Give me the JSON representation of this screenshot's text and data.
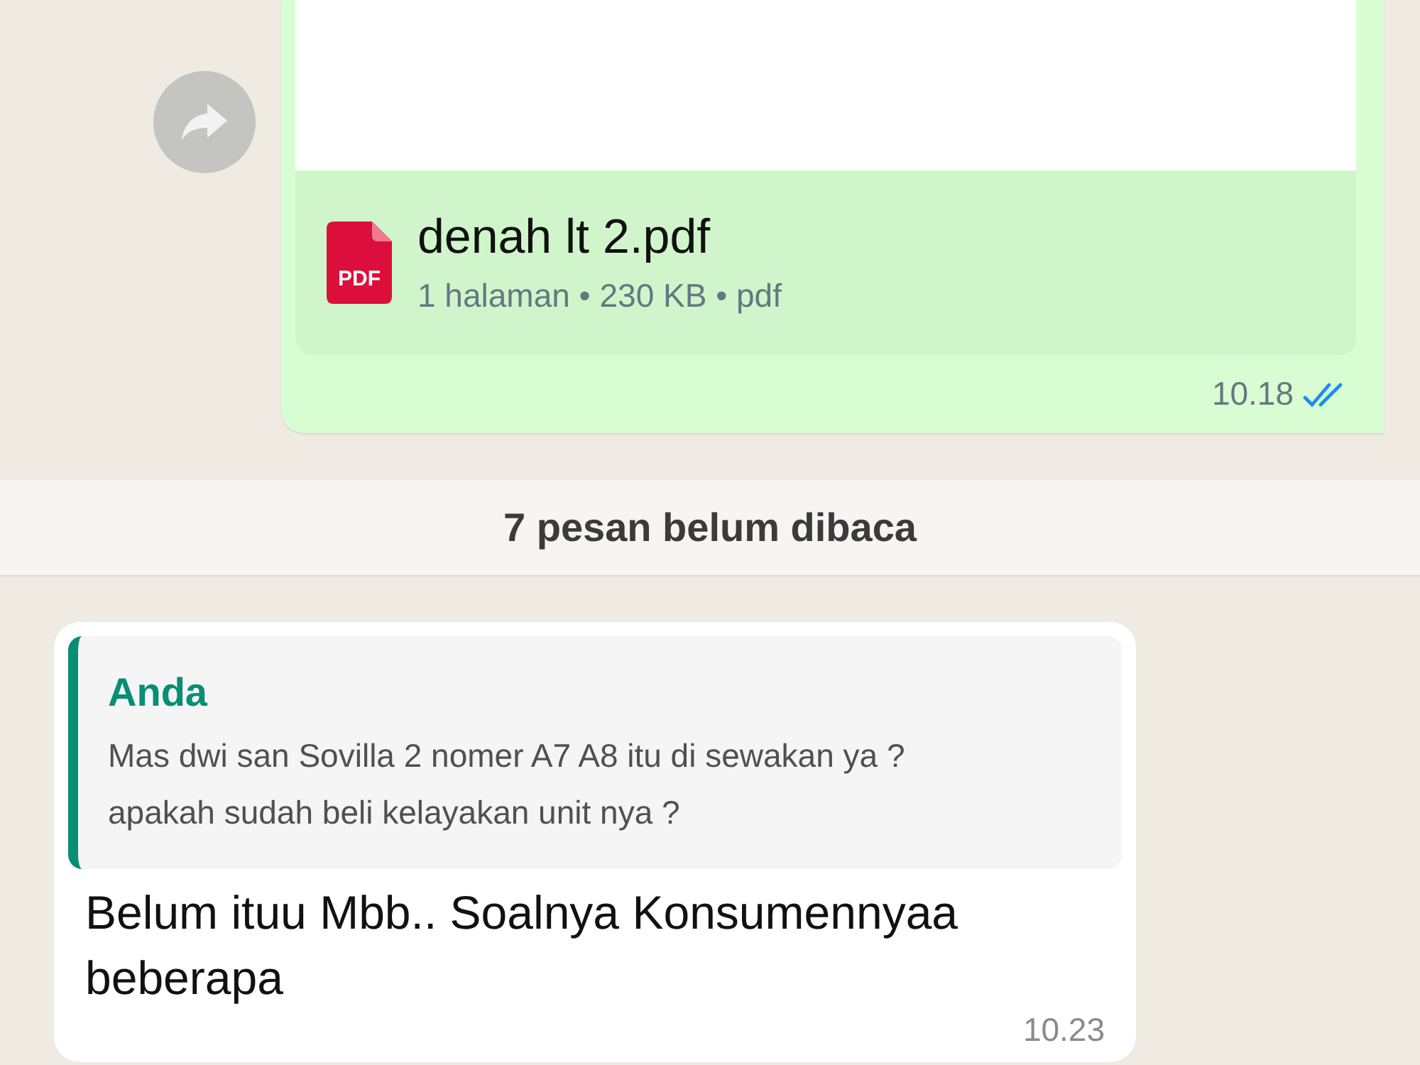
{
  "outgoing_message": {
    "file_name": "denah lt 2.pdf",
    "file_meta": "1 halaman • 230 KB • pdf",
    "file_type_label": "PDF",
    "time": "10.18",
    "read": true
  },
  "unread_divider": {
    "text": "7 pesan belum dibaca"
  },
  "incoming_message": {
    "quote": {
      "author": "Anda",
      "text": "Mas dwi san Sovilla 2 nomer A7 A8 itu di sewakan ya ?apakah sudah beli kelayakan unit nya ?"
    },
    "text": "Belum ituu Mbb.. Soalnya Konsumennyaa beberapa",
    "time": "10.23"
  }
}
